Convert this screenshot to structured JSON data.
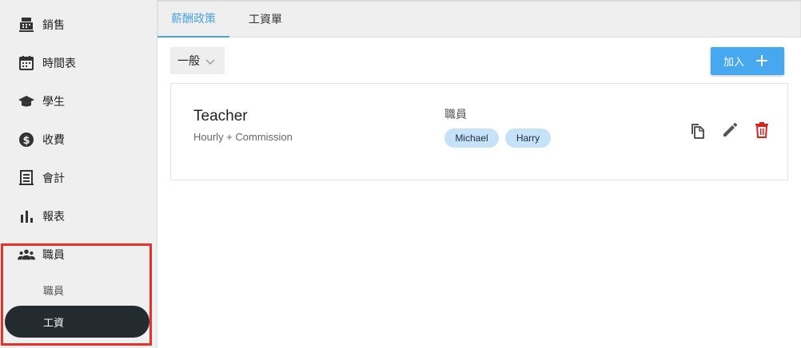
{
  "sidebar": {
    "items": [
      {
        "label": "銷售",
        "icon": "cash-register-icon"
      },
      {
        "label": "時間表",
        "icon": "calendar-icon"
      },
      {
        "label": "學生",
        "icon": "graduation-cap-icon"
      },
      {
        "label": "收費",
        "icon": "dollar-circle-icon"
      },
      {
        "label": "會計",
        "icon": "ledger-icon"
      },
      {
        "label": "報表",
        "icon": "bar-chart-icon"
      },
      {
        "label": "職員",
        "icon": "people-icon"
      }
    ],
    "subitems": [
      {
        "label": "職員"
      },
      {
        "label": "工資",
        "active": true
      }
    ]
  },
  "tabs": [
    {
      "label": "薪酬政策",
      "active": true
    },
    {
      "label": "工資單"
    }
  ],
  "filter": {
    "value": "一般"
  },
  "add_button": {
    "label": "加入"
  },
  "card": {
    "title": "Teacher",
    "subtitle": "Hourly + Commission",
    "staff_label": "職員",
    "staff": [
      "Michael",
      "Harry"
    ]
  },
  "colors": {
    "accent": "#47a7ef",
    "tab_active": "#4ba3e3",
    "chip_bg": "#c6e2f8",
    "active_nav_bg": "#232a30",
    "delete": "#e0201b",
    "highlight": "#e8312a"
  }
}
